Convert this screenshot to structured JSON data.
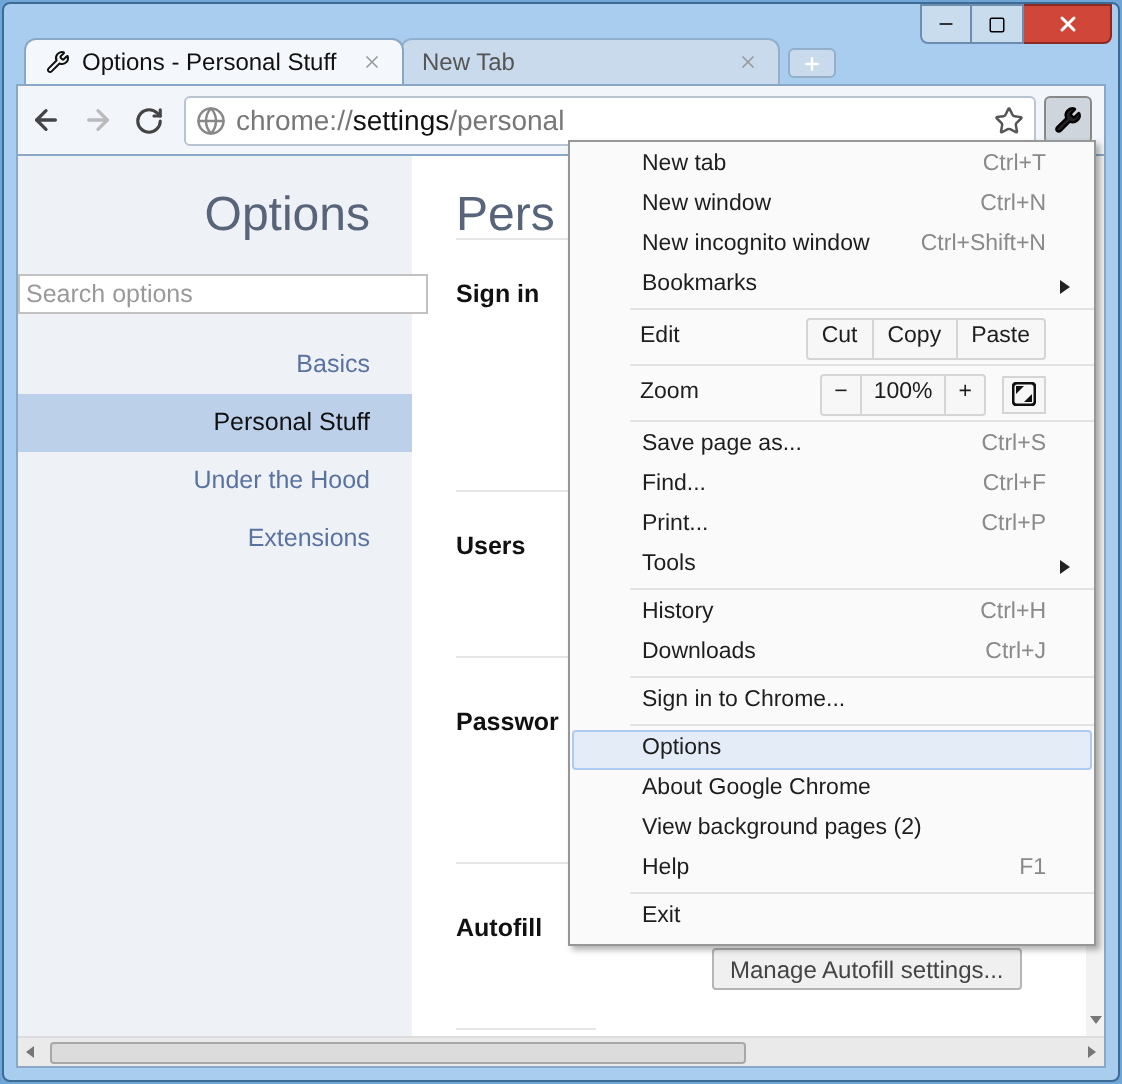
{
  "tabs": [
    {
      "title": "Options - Personal Stuff",
      "selected": true
    },
    {
      "title": "New Tab",
      "selected": false
    }
  ],
  "address": {
    "scheme": "chrome://",
    "host": "settings",
    "path": "/personal"
  },
  "sidebar": {
    "title": "Options",
    "search": {
      "placeholder": "Search options"
    },
    "items": [
      {
        "label": "Basics",
        "selected": false
      },
      {
        "label": "Personal Stuff",
        "selected": true
      },
      {
        "label": "Under the Hood",
        "selected": false
      },
      {
        "label": "Extensions",
        "selected": false
      }
    ]
  },
  "content": {
    "heading": "Pers",
    "sections": [
      {
        "title": "Sign in"
      },
      {
        "title": "Users"
      },
      {
        "title": "Passwor"
      },
      {
        "title": "Autofill",
        "button": "Manage Autofill settings..."
      }
    ]
  },
  "menu": {
    "groups": [
      [
        {
          "kind": "item",
          "label": "New tab",
          "shortcut": "Ctrl+T",
          "selected": false
        },
        {
          "kind": "item",
          "label": "New window",
          "shortcut": "Ctrl+N",
          "selected": false
        },
        {
          "kind": "item",
          "label": "New incognito window",
          "shortcut": "Ctrl+Shift+N",
          "selected": false
        },
        {
          "kind": "submenu",
          "label": "Bookmarks",
          "selected": false
        }
      ],
      [
        {
          "kind": "buttons",
          "label": "Edit",
          "buttons": [
            "Cut",
            "Copy",
            "Paste"
          ],
          "selected": false
        }
      ],
      [
        {
          "kind": "zoom",
          "label": "Zoom",
          "buttons": [
            "−",
            "100%",
            "+"
          ],
          "selected": false
        }
      ],
      [
        {
          "kind": "item",
          "label": "Save page as...",
          "shortcut": "Ctrl+S",
          "selected": false
        },
        {
          "kind": "item",
          "label": "Find...",
          "shortcut": "Ctrl+F",
          "selected": false
        },
        {
          "kind": "item",
          "label": "Print...",
          "shortcut": "Ctrl+P",
          "selected": false
        },
        {
          "kind": "submenu",
          "label": "Tools",
          "selected": false
        }
      ],
      [
        {
          "kind": "item",
          "label": "History",
          "shortcut": "Ctrl+H",
          "selected": false
        },
        {
          "kind": "item",
          "label": "Downloads",
          "shortcut": "Ctrl+J",
          "selected": false
        }
      ],
      [
        {
          "kind": "item",
          "label": "Sign in to Chrome...",
          "selected": false
        }
      ],
      [
        {
          "kind": "item",
          "label": "Options",
          "selected": true
        },
        {
          "kind": "item",
          "label": "About Google Chrome",
          "selected": false
        },
        {
          "kind": "item",
          "label": "View background pages (2)",
          "selected": false
        },
        {
          "kind": "item",
          "label": "Help",
          "shortcut": "F1",
          "selected": false
        }
      ],
      [
        {
          "kind": "item",
          "label": "Exit",
          "selected": false
        }
      ]
    ]
  }
}
